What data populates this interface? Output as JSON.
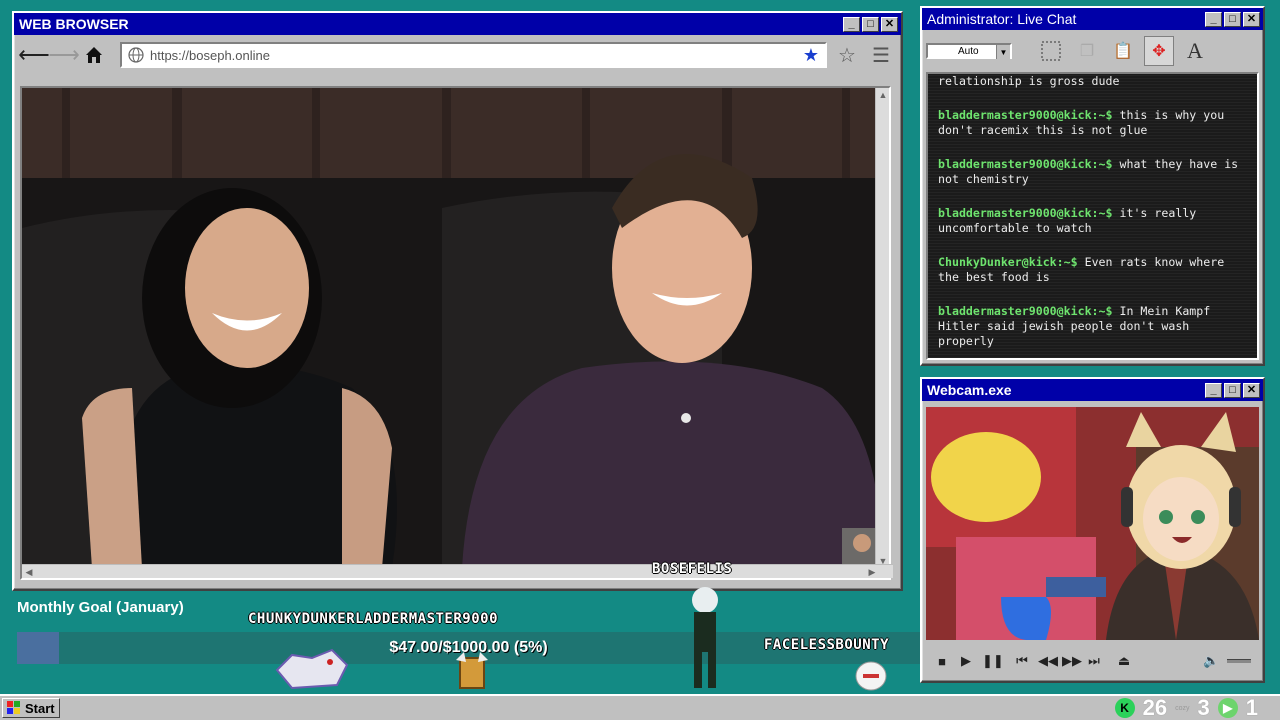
{
  "browser": {
    "title": "WEB BROWSER",
    "url": "https://boseph.online"
  },
  "chat": {
    "title": "Administrator: Live Chat",
    "auto_label": "Auto",
    "partial_top": "relationship is gross dude",
    "messages": [
      {
        "user": "bladdermaster9000@kick:~$",
        "text": " this is why you don't racemix this is not glue"
      },
      {
        "user": "bladdermaster9000@kick:~$",
        "text": " what they have is not chemistry"
      },
      {
        "user": "bladdermaster9000@kick:~$",
        "text": " it's really uncomfortable to watch"
      },
      {
        "user": "ChunkyDunker@kick:~$",
        "text": " Even rats know where the best food is"
      },
      {
        "user": "bladdermaster9000@kick:~$",
        "text": " In Mein Kampf Hitler said jewish people don't wash properly"
      }
    ]
  },
  "webcam": {
    "title": "Webcam.exe"
  },
  "goal": {
    "title": "Monthly Goal (January)",
    "text": "$47.00/$1000.00 (5%)",
    "progress": 0.047
  },
  "names": {
    "n1": "CHUNKYDUNKERLADDERMASTER9000",
    "n2": "BOSEFELIS",
    "n3": "FACELESSBOUNTY"
  },
  "taskbar": {
    "start": "Start",
    "tray_num1": "26",
    "tray_small": "cozy",
    "tray_num2": "3",
    "tray_num3": "1"
  },
  "colors": {
    "desktop": "#138a84",
    "titlebar": "#0000a8",
    "chat_user": "#6ee36e"
  }
}
